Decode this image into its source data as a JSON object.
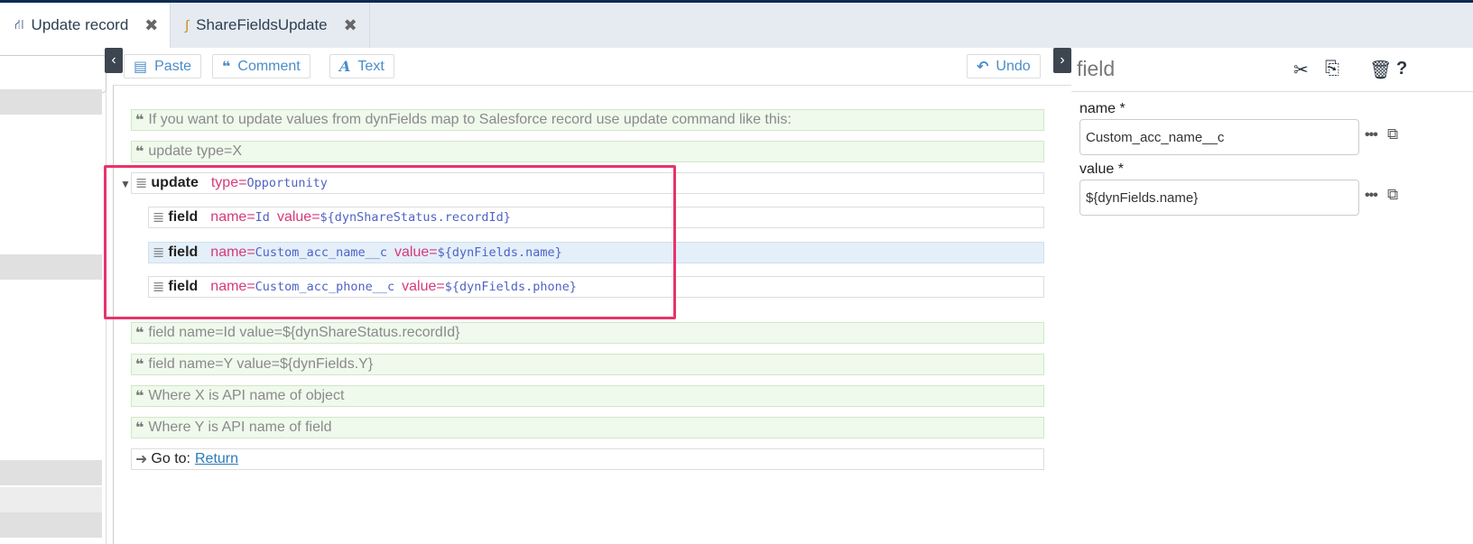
{
  "tabs": [
    {
      "label": "Update record",
      "icon": "flow-icon",
      "active": true
    },
    {
      "label": "ShareFieldsUpdate",
      "icon": "subflow-icon",
      "active": false
    }
  ],
  "toolbar": {
    "paste_label": "Paste",
    "comment_label": "Comment",
    "text_label": "Text",
    "undo_label": "Undo"
  },
  "editor": {
    "comments_top": [
      "If you want to update values from dynFields map to Salesforce record use update command like this:",
      "update type=X"
    ],
    "update_block": {
      "keyword": "update",
      "type_attr": "type=",
      "type_value": "Opportunity",
      "fields": [
        {
          "keyword": "field",
          "name_attr": "name=",
          "name_value": "Id",
          "value_attr": "value=",
          "value_value": "${dynShareStatus.recordId}"
        },
        {
          "keyword": "field",
          "name_attr": "name=",
          "name_value": "Custom_acc_name__c",
          "value_attr": "value=",
          "value_value": "${dynFields.name}"
        },
        {
          "keyword": "field",
          "name_attr": "name=",
          "name_value": "Custom_acc_phone__c",
          "value_attr": "value=",
          "value_value": "${dynFields.phone}"
        }
      ]
    },
    "comments_bottom": [
      "field name=Id value=${dynShareStatus.recordId}",
      "field name=Y value=${dynFields.Y}",
      "Where X is API name of object",
      "Where Y is API name of field"
    ],
    "goto_label": "Go to:",
    "goto_link": "Return"
  },
  "inspector": {
    "title": "field",
    "name_label": "name *",
    "name_value": "Custom_acc_name__c",
    "value_label": "value *",
    "value_value": "${dynFields.name}",
    "help_glyph": "?"
  },
  "colors": {
    "highlight": "#e8336a",
    "comment_bg": "#eff9ec",
    "selected_bg": "#e4eff9",
    "attr_name": "#d63a7a",
    "attr_value": "#4f63c6"
  }
}
